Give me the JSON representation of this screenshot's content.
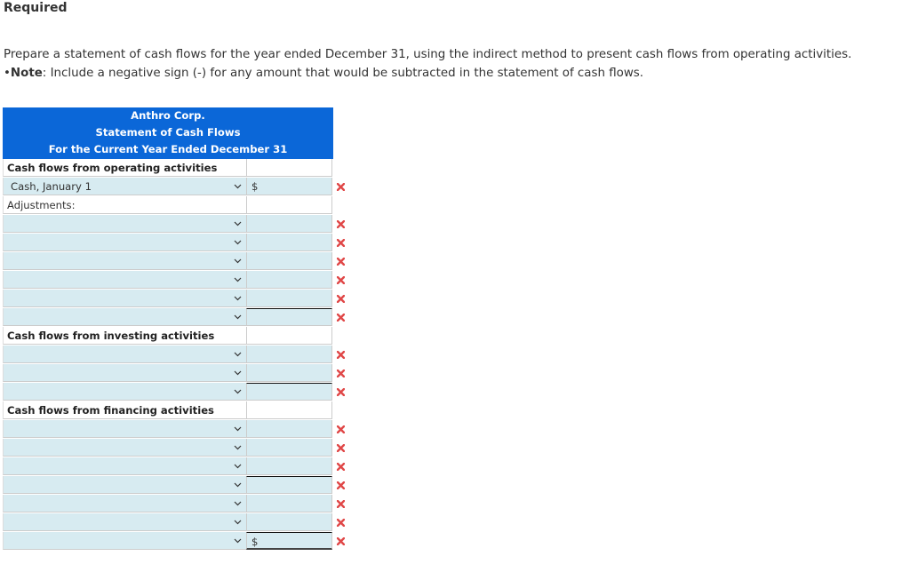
{
  "required_heading": "Required",
  "instructions": {
    "line1": "Prepare a statement of cash flows for the year ended December 31, using the indirect method to present cash flows from operating activities.",
    "note_bullet": "•",
    "note_label": "Note",
    "note_text": ": Include a negative sign (-) for any amount that would be subtracted in the statement of cash flows."
  },
  "statement": {
    "company": "Anthro Corp.",
    "title": "Statement of Cash Flows",
    "period": "For the Current Year Ended December 31",
    "operating": {
      "header": "Cash flows from operating activities",
      "first_row_label": "Cash, January 1",
      "first_row_prefix": "$",
      "adjustments_label": "Adjustments:"
    },
    "investing": {
      "header": "Cash flows from investing activities"
    },
    "financing": {
      "header": "Cash flows from financing activities",
      "last_row_prefix": "$"
    }
  },
  "status_icon": "incorrect-x-icon",
  "colors": {
    "header_bg": "#0b67d8",
    "input_bg": "#d7ebf1",
    "incorrect": "#e04848"
  }
}
